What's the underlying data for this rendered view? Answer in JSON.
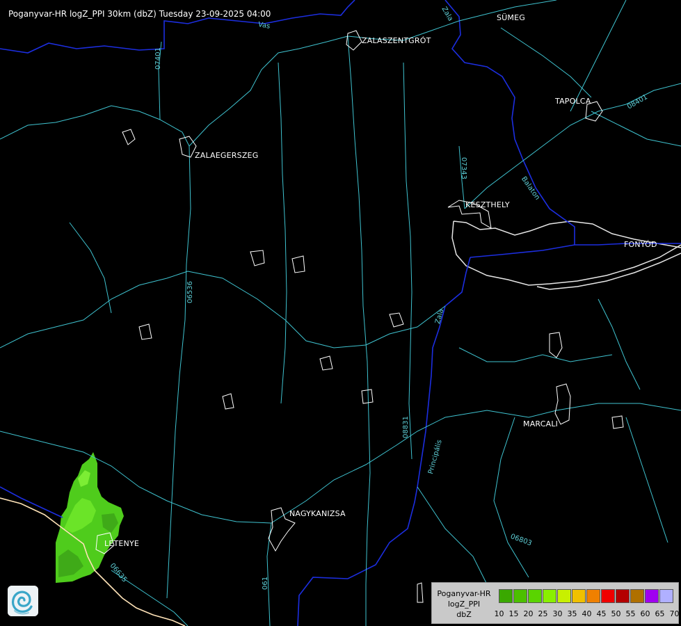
{
  "title": "Poganyvar-HR logZ_PPI 30km (dbZ) Tuesday 23-09-2025 04:00",
  "cities": [
    {
      "id": "sumeg",
      "name": "SÜMEG"
    },
    {
      "id": "zalaszentgrot",
      "name": "ZALASZENTGRÓT"
    },
    {
      "id": "tapolca",
      "name": "TAPOLCA"
    },
    {
      "id": "zalaegerszeg",
      "name": "ZALAEGERSZEG"
    },
    {
      "id": "keszthely",
      "name": "KESZTHELY"
    },
    {
      "id": "fonyod",
      "name": "FONYÓD"
    },
    {
      "id": "marcali",
      "name": "MARCALI"
    },
    {
      "id": "nagykanizsa",
      "name": "NAGYKANIZSA"
    },
    {
      "id": "letenye",
      "name": "LETENYE"
    }
  ],
  "road_labels": [
    "07401",
    "07343",
    "08401",
    "06536",
    "08831",
    "06803",
    "06635",
    "061"
  ],
  "water_labels": [
    "Vas",
    "Zala",
    "Balaton",
    "Zala",
    "Principális"
  ],
  "legend": {
    "line1": "Poganyvar-HR",
    "line2": "logZ_PPI",
    "line3": "dbZ",
    "ticks": [
      "10",
      "15",
      "20",
      "25",
      "30",
      "35",
      "40",
      "45",
      "50",
      "55",
      "60",
      "65",
      "70"
    ],
    "colors": [
      "#3aa800",
      "#4cc000",
      "#5ad400",
      "#8af000",
      "#c8f000",
      "#f0c000",
      "#f08000",
      "#f00000",
      "#b40000",
      "#b07000",
      "#a000f0",
      "#b0b0ff"
    ]
  },
  "colors": {
    "road": "#3fc3d0",
    "water": "#1c2ee0",
    "border": "#ffe3b8",
    "rain": "#58d220"
  },
  "icons": {
    "logo": "swirl-logo-icon"
  }
}
